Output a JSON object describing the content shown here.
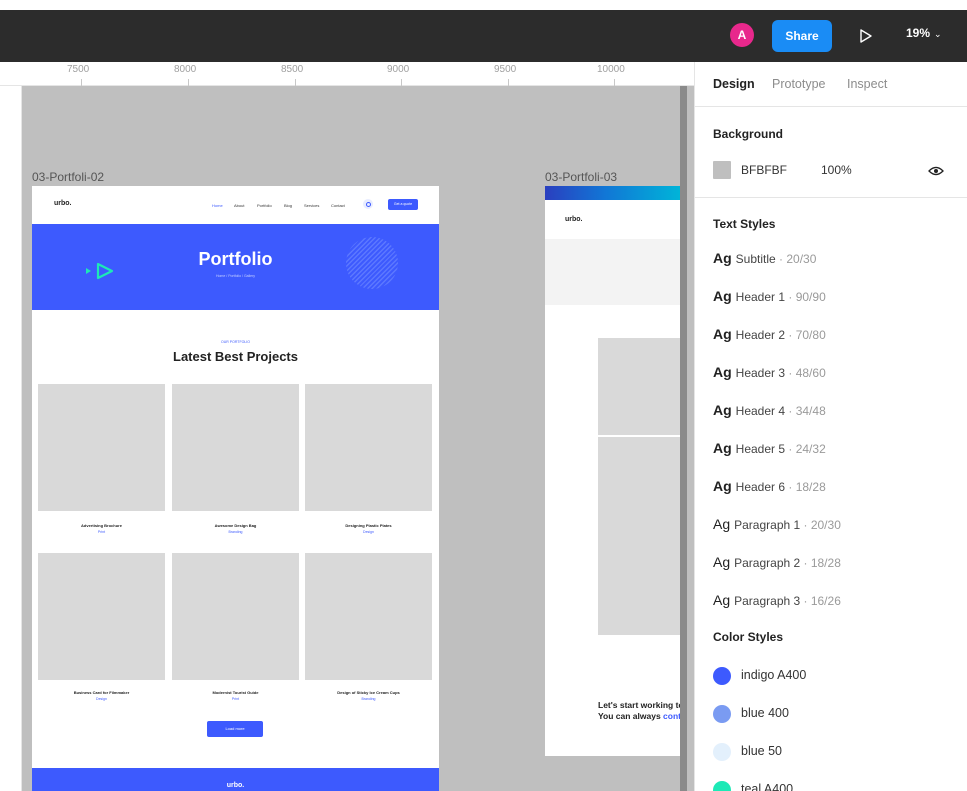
{
  "toolbar": {
    "avatar_initial": "A",
    "share_label": "Share",
    "zoom": "19%"
  },
  "ruler": {
    "labels": [
      "7500",
      "8000",
      "8500",
      "9000",
      "9500",
      "10000"
    ]
  },
  "canvas": {
    "background": "#BFBFBF",
    "frame1": {
      "label": "03-Portfoli-02",
      "logo": "urbo.",
      "nav": [
        "Home",
        "About",
        "Portfolio",
        "Blog",
        "Services",
        "Contact"
      ],
      "quote_button": "Get a quote",
      "hero_title": "Portfolio",
      "hero_breadcrumb": "Home / Portfolio / Gallery",
      "eyebrow": "OUR PORTFOLIO",
      "section_title": "Latest Best Projects",
      "projects": [
        {
          "title": "Advertising Brochure",
          "category": "Print"
        },
        {
          "title": "Awesome Design Bag",
          "category": "Branding"
        },
        {
          "title": "Designing Plastic Plates",
          "category": "Design"
        },
        {
          "title": "Business Card for Filmmaker",
          "category": "Design"
        },
        {
          "title": "Modernist Tourist Guide",
          "category": "Print"
        },
        {
          "title": "Design of Sticky Ice Cream Cups",
          "category": "Branding"
        }
      ],
      "load_more": "Load more",
      "footer_logo": "urbo."
    },
    "frame2": {
      "label": "03-Portfoli-03",
      "logo": "urbo.",
      "cta_line1": "Let's start working to",
      "cta_line2_prefix": "You can always ",
      "cta_line2_link": "conta"
    }
  },
  "panel": {
    "tabs": [
      "Design",
      "Prototype",
      "Inspect"
    ],
    "active_tab": "Design",
    "background": {
      "title": "Background",
      "hex": "BFBFBF",
      "opacity": "100%"
    },
    "text_styles": {
      "title": "Text Styles",
      "items": [
        {
          "ag": "Ag",
          "name": "Subtitle",
          "meta": " · 20/30",
          "bold": true
        },
        {
          "ag": "Ag",
          "name": "Header 1",
          "meta": " · 90/90",
          "bold": true
        },
        {
          "ag": "Ag",
          "name": "Header 2",
          "meta": " · 70/80",
          "bold": true
        },
        {
          "ag": "Ag",
          "name": "Header 3",
          "meta": " · 48/60",
          "bold": true
        },
        {
          "ag": "Ag",
          "name": "Header 4",
          "meta": " · 34/48",
          "bold": true
        },
        {
          "ag": "Ag",
          "name": "Header 5",
          "meta": " · 24/32",
          "bold": true
        },
        {
          "ag": "Ag",
          "name": "Header 6",
          "meta": " · 18/28",
          "bold": true
        },
        {
          "ag": "Ag",
          "name": "Paragraph 1",
          "meta": " · 20/30",
          "bold": false
        },
        {
          "ag": "Ag",
          "name": "Paragraph 2",
          "meta": " · 18/28",
          "bold": false
        },
        {
          "ag": "Ag",
          "name": "Paragraph 3",
          "meta": " · 16/26",
          "bold": false
        }
      ]
    },
    "color_styles": {
      "title": "Color Styles",
      "items": [
        {
          "name": "indigo A400",
          "color": "#3D5AFE"
        },
        {
          "name": "blue 400",
          "color": "#7A9BF2"
        },
        {
          "name": "blue 50",
          "color": "#E3F0FC"
        },
        {
          "name": "teal A400",
          "color": "#1DE9B6"
        }
      ]
    }
  }
}
